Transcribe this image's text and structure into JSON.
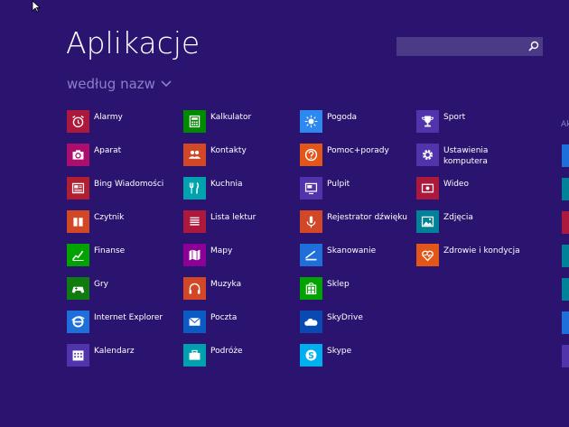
{
  "header": {
    "title": "Aplikacje",
    "sort_label": "według nazw"
  },
  "search": {
    "placeholder": ""
  },
  "edge": {
    "label": "Ak"
  },
  "apps": [
    {
      "label": "Alarmy",
      "color": "#ac193d",
      "icon": "alarm-clock-icon"
    },
    {
      "label": "Aparat",
      "color": "#ac0e6d",
      "icon": "camera-icon"
    },
    {
      "label": "Bing Wiadomości",
      "color": "#b01e2f",
      "icon": "news-icon"
    },
    {
      "label": "Czytnik",
      "color": "#d24726",
      "icon": "reader-icon"
    },
    {
      "label": "Finanse",
      "color": "#00a300",
      "icon": "finance-chart-icon"
    },
    {
      "label": "Gry",
      "color": "#107c10",
      "icon": "gamepad-icon"
    },
    {
      "label": "Internet Explorer",
      "color": "#1e6fd9",
      "icon": "internet-explorer-icon"
    },
    {
      "label": "Kalendarz",
      "color": "#5133ab",
      "icon": "calendar-icon"
    },
    {
      "label": "Kalkulator",
      "color": "#008a00",
      "icon": "calculator-icon"
    },
    {
      "label": "Kontakty",
      "color": "#d24726",
      "icon": "people-icon"
    },
    {
      "label": "Kuchnia",
      "color": "#00a2ad",
      "icon": "fork-knife-icon"
    },
    {
      "label": "Lista lektur",
      "color": "#ac193d",
      "icon": "list-icon"
    },
    {
      "label": "Mapy",
      "color": "#8c0095",
      "icon": "map-icon"
    },
    {
      "label": "Muzyka",
      "color": "#d24726",
      "icon": "headphones-icon"
    },
    {
      "label": "Poczta",
      "color": "#0a5bc4",
      "icon": "mail-icon"
    },
    {
      "label": "Podróże",
      "color": "#00a0b1",
      "icon": "suitcase-icon"
    },
    {
      "label": "Pogoda",
      "color": "#2d89ef",
      "icon": "sun-icon"
    },
    {
      "label": "Pomoc+porady",
      "color": "#e3561a",
      "icon": "help-icon"
    },
    {
      "label": "Pulpit",
      "color": "#5133ab",
      "icon": "desktop-icon"
    },
    {
      "label": "Rejestrator dźwięku",
      "color": "#d24726",
      "icon": "microphone-icon"
    },
    {
      "label": "Skanowanie",
      "color": "#1e6fd9",
      "icon": "scanner-icon"
    },
    {
      "label": "Sklep",
      "color": "#00a300",
      "icon": "store-icon"
    },
    {
      "label": "SkyDrive",
      "color": "#094ab2",
      "icon": "cloud-icon"
    },
    {
      "label": "Skype",
      "color": "#00aff0",
      "icon": "skype-icon"
    },
    {
      "label": "Sport",
      "color": "#5133ab",
      "icon": "trophy-icon"
    },
    {
      "label": "Ustawienia komputera",
      "color": "#5133ab",
      "icon": "gear-icon"
    },
    {
      "label": "Wideo",
      "color": "#ac193d",
      "icon": "video-icon"
    },
    {
      "label": "Zdjęcia",
      "color": "#008299",
      "icon": "photo-icon"
    },
    {
      "label": "Zdrowie i kondycja",
      "color": "#e3561a",
      "icon": "heart-pulse-icon"
    }
  ],
  "edge_tiles": [
    {
      "color": "#1e6fd9"
    },
    {
      "color": "#008299"
    },
    {
      "color": "#ac193d"
    },
    {
      "color": "#008299"
    },
    {
      "color": "#008299"
    },
    {
      "color": "#1e6fd9"
    },
    {
      "color": "#5133ab"
    }
  ]
}
